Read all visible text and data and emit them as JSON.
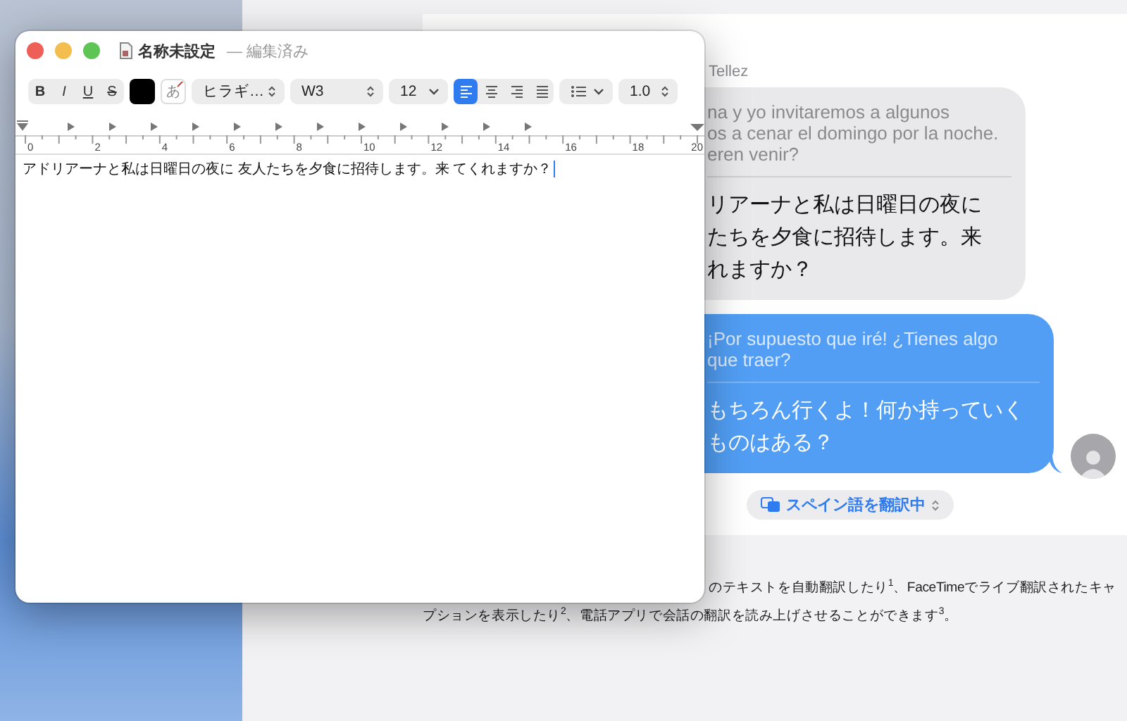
{
  "editor": {
    "title": "名称未設定",
    "status": "— 編集済み",
    "toolbar": {
      "style_buttons": [
        {
          "label": "B",
          "kind": "bold"
        },
        {
          "label": "I",
          "kind": "italic"
        },
        {
          "label": "U",
          "kind": "underline"
        },
        {
          "label": "S",
          "kind": "strikethrough"
        }
      ],
      "no_background_glyph": "あ",
      "font_family": "ヒラギ…",
      "font_weight": "W3",
      "font_size": "12",
      "alignments": [
        {
          "kind": "left",
          "selected": true
        },
        {
          "kind": "center",
          "selected": false
        },
        {
          "kind": "right",
          "selected": false
        },
        {
          "kind": "justify",
          "selected": false
        }
      ],
      "line_spacing": "1.0"
    },
    "ruler": {
      "labels": [
        "0",
        "2",
        "4",
        "6",
        "8",
        "10",
        "12",
        "14",
        "16",
        "18",
        "20"
      ]
    },
    "document_text": "アドリアーナと私は日曜日の夜に 友人たちを夕食に招待します。来 てくれますか？"
  },
  "messages": {
    "sender": "Tellez",
    "bubbles": [
      {
        "kind": "received",
        "original": "na y yo invitaremos a algunos\nos a cenar el domingo por la noche.\neren venir?",
        "translation": [
          "リアーナと私は日曜日の夜に",
          "たちを夕食に招待します。来",
          "れますか？"
        ]
      },
      {
        "kind": "sent",
        "original": "¡Por supuesto que iré! ¿Tienes algo\nque traer?",
        "translation": [
          "もちろん行くよ！何か持っていく",
          "ものはある？"
        ]
      }
    ],
    "translate_pill": "スペイン語を翻訳中"
  },
  "caption": {
    "lines": [
      "のテキストを自動翻訳したり$^{1}$、FaceTimeでライブ翻訳されたキャ",
      "プションを表示したり$^{2}$、電話アプリで会話の翻訳を読み上げさせることができます$^{3}$。"
    ]
  }
}
